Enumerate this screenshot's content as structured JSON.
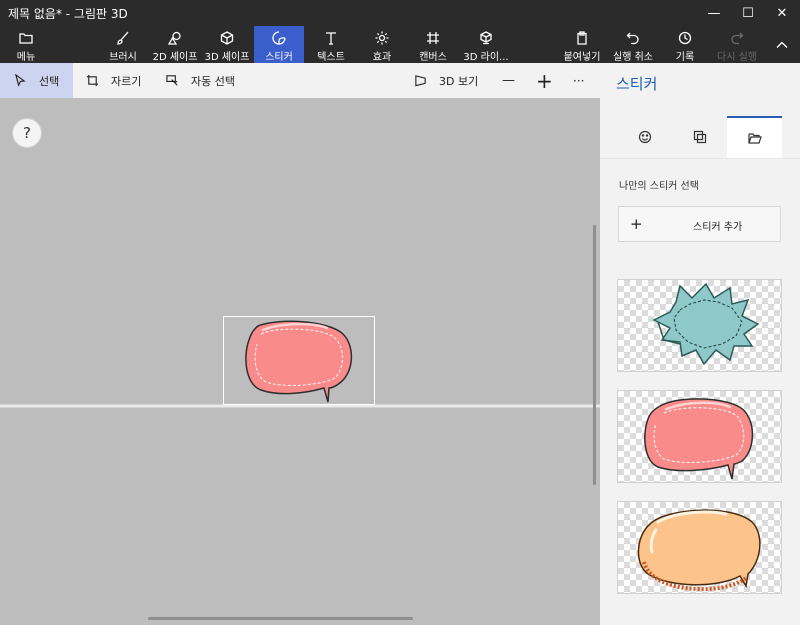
{
  "window": {
    "title": "제목 없음* - 그림판 3D",
    "minimize_glyph": "—",
    "maximize_glyph": "☐",
    "close_glyph": "✕"
  },
  "ribbon": {
    "menu": "메뉴",
    "tools": [
      {
        "id": "brush",
        "label": "브러시",
        "icon": "brush-icon"
      },
      {
        "id": "shapes2d",
        "label": "2D 셰이프",
        "icon": "shapes-2d-icon"
      },
      {
        "id": "shapes3d",
        "label": "3D 셰이프",
        "icon": "cube-icon"
      },
      {
        "id": "stickers",
        "label": "스티커",
        "icon": "sticker-icon",
        "active": true
      },
      {
        "id": "text",
        "label": "텍스트",
        "icon": "text-icon"
      },
      {
        "id": "effects",
        "label": "효과",
        "icon": "sun-icon"
      },
      {
        "id": "canvas",
        "label": "캔버스",
        "icon": "canvas-icon"
      },
      {
        "id": "library3d",
        "label": "3D 라이...",
        "icon": "library-icon"
      }
    ],
    "paste": "붙여넣기",
    "undo": "실행 취소",
    "history": "기록",
    "redo": "다시 실행",
    "collapse_icon": "chevron-up-icon"
  },
  "toolbar": {
    "select": "선택",
    "crop": "자르기",
    "magic_select": "자동 선택",
    "view3d": "3D 보기",
    "zoom_out": "—",
    "zoom_in": "+",
    "more": "···"
  },
  "canvas": {
    "help": "?"
  },
  "panel": {
    "title": "스티커",
    "tabs": [
      "stickers-tab",
      "textures-tab",
      "my-stickers-tab"
    ],
    "active_tab": "my-stickers-tab",
    "section_label": "나만의 스티커 선택",
    "add_button": {
      "plus": "+",
      "label": "스티커 추가"
    },
    "stickers": [
      {
        "name": "spiky-speech-bubble",
        "color": "#8fc8c8"
      },
      {
        "name": "pink-speech-bubble",
        "color": "#f98b8b"
      },
      {
        "name": "orange-speech-bubble",
        "color": "#fcc48a"
      }
    ]
  },
  "colors": {
    "accent": "#3a5fcd",
    "panel_accent": "#1a5fb4",
    "dark": "#2b2b2b"
  }
}
